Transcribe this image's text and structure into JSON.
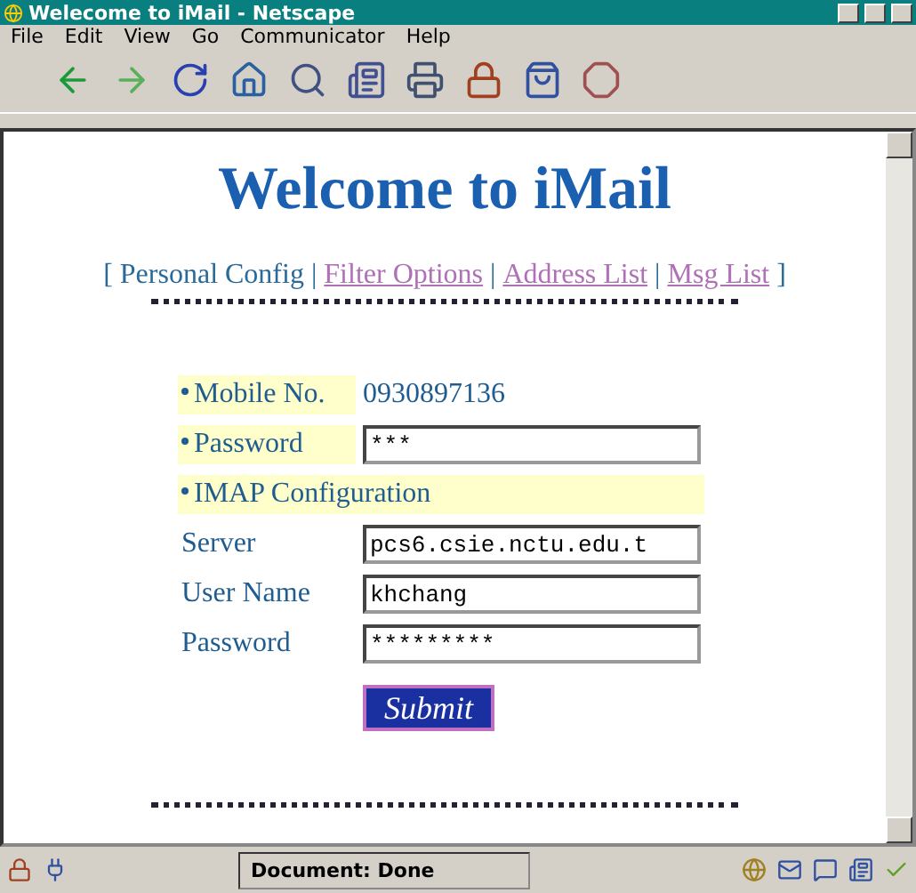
{
  "window": {
    "title": "Welecome to iMail - Netscape"
  },
  "menu": [
    "File",
    "Edit",
    "View",
    "Go",
    "Communicator",
    "Help"
  ],
  "heading": "Welcome to iMail",
  "nav": [
    {
      "label": "Personal Config",
      "selected": true
    },
    {
      "label": "Filter Options",
      "selected": false
    },
    {
      "label": "Address List",
      "selected": false
    },
    {
      "label": "Msg List",
      "selected": false
    }
  ],
  "nav_brackets": [
    "[",
    "]"
  ],
  "nav_separator": "|",
  "form": [
    {
      "kind": "text",
      "label": "Mobile No.",
      "value": "0930897136",
      "bullet": true
    },
    {
      "kind": "field",
      "label": "Password",
      "value": "***",
      "bullet": true
    },
    {
      "kind": "section",
      "label": "IMAP Configuration",
      "bullet": true
    },
    {
      "kind": "field",
      "label": "Server",
      "value": "pcs6.csie.nctu.edu.t",
      "bullet": false
    },
    {
      "kind": "field",
      "label": "User Name",
      "value": "khchang",
      "bullet": false
    },
    {
      "kind": "field",
      "label": "Password",
      "value": "*********",
      "bullet": false
    }
  ],
  "submit": "Submit",
  "status_bar": {
    "text": "Document: Done"
  }
}
